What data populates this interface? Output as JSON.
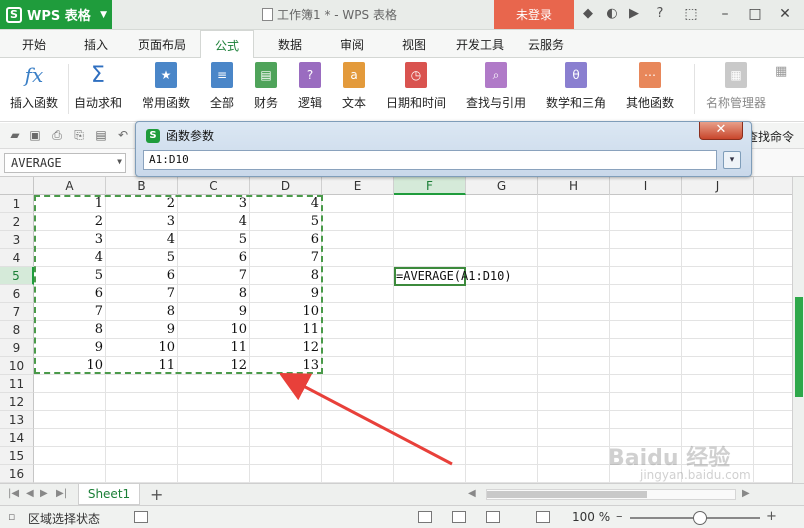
{
  "app": {
    "name": "WPS 表格",
    "doc_title": "工作簿1 * - WPS 表格",
    "login": "未登录"
  },
  "menu": {
    "tabs": [
      "开始",
      "插入",
      "页面布局",
      "公式",
      "数据",
      "审阅",
      "视图",
      "开发工具",
      "云服务"
    ],
    "active": "公式"
  },
  "ribbon": {
    "insert_function": "插入函数",
    "autosum": "自动求和",
    "common_functions": "常用函数",
    "all": "全部",
    "financial": "财务",
    "logical": "逻辑",
    "text": "文本",
    "datetime": "日期和时间",
    "lookup": "查找与引用",
    "math": "数学和三角",
    "other": "其他函数",
    "name_manager": "名称管理器",
    "find_command": "查找命令"
  },
  "namebox": {
    "value": "AVERAGE"
  },
  "dialog": {
    "title": "函数参数",
    "input_value": "A1:D10",
    "close_symbol": "✕"
  },
  "sheet": {
    "columns": [
      "A",
      "B",
      "C",
      "D",
      "E",
      "F",
      "G",
      "H",
      "I",
      "J"
    ],
    "rows": [
      "1",
      "2",
      "3",
      "4",
      "5",
      "6",
      "7",
      "8",
      "9",
      "10",
      "11",
      "12",
      "13",
      "14",
      "15",
      "16"
    ],
    "selected_column": "F",
    "selected_row": "5",
    "data": [
      [
        "1",
        "2",
        "3",
        "4"
      ],
      [
        "2",
        "3",
        "4",
        "5"
      ],
      [
        "3",
        "4",
        "5",
        "6"
      ],
      [
        "4",
        "5",
        "6",
        "7"
      ],
      [
        "5",
        "6",
        "7",
        "8"
      ],
      [
        "6",
        "7",
        "8",
        "9"
      ],
      [
        "7",
        "8",
        "9",
        "10"
      ],
      [
        "8",
        "9",
        "10",
        "11"
      ],
      [
        "9",
        "10",
        "11",
        "12"
      ],
      [
        "10",
        "11",
        "12",
        "13"
      ]
    ],
    "formula": "=AVERAGE(A1:D10)"
  },
  "sheetbar": {
    "tab": "Sheet1",
    "add": "+"
  },
  "status": {
    "text": "区域选择状态",
    "zoom": "100 %"
  },
  "watermark": {
    "main": "Baidu 经验",
    "sub": "jingyan.baidu.com"
  },
  "colors": {
    "accent": "#1f9c3c",
    "login": "#e8664d",
    "arrow": "#e8403a"
  }
}
